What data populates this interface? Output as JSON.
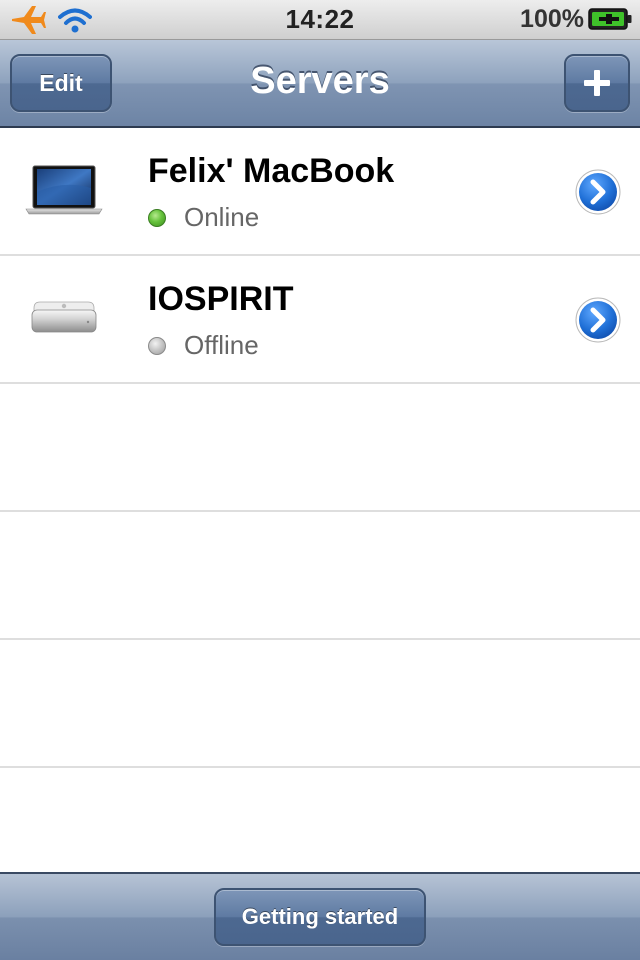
{
  "status_bar": {
    "time": "14:22",
    "battery_percent": "100%",
    "icons": [
      "airplane-mode-icon",
      "wifi-icon",
      "battery-charging-icon"
    ]
  },
  "nav_bar": {
    "title": "Servers",
    "edit_label": "Edit",
    "add_label": "+"
  },
  "servers": [
    {
      "name": "Felix' MacBook",
      "status": "Online",
      "status_color": "#66c23c",
      "device_icon": "macbook-icon"
    },
    {
      "name": "IOSPIRIT",
      "status": "Offline",
      "status_color": "#c4c4c4",
      "device_icon": "mac-mini-icon"
    }
  ],
  "toolbar": {
    "getting_started_label": "Getting started"
  },
  "colors": {
    "nav_bar": "#8ea2bd",
    "button": "#5e7aa2",
    "accent_blue": "#1f6fd6"
  }
}
